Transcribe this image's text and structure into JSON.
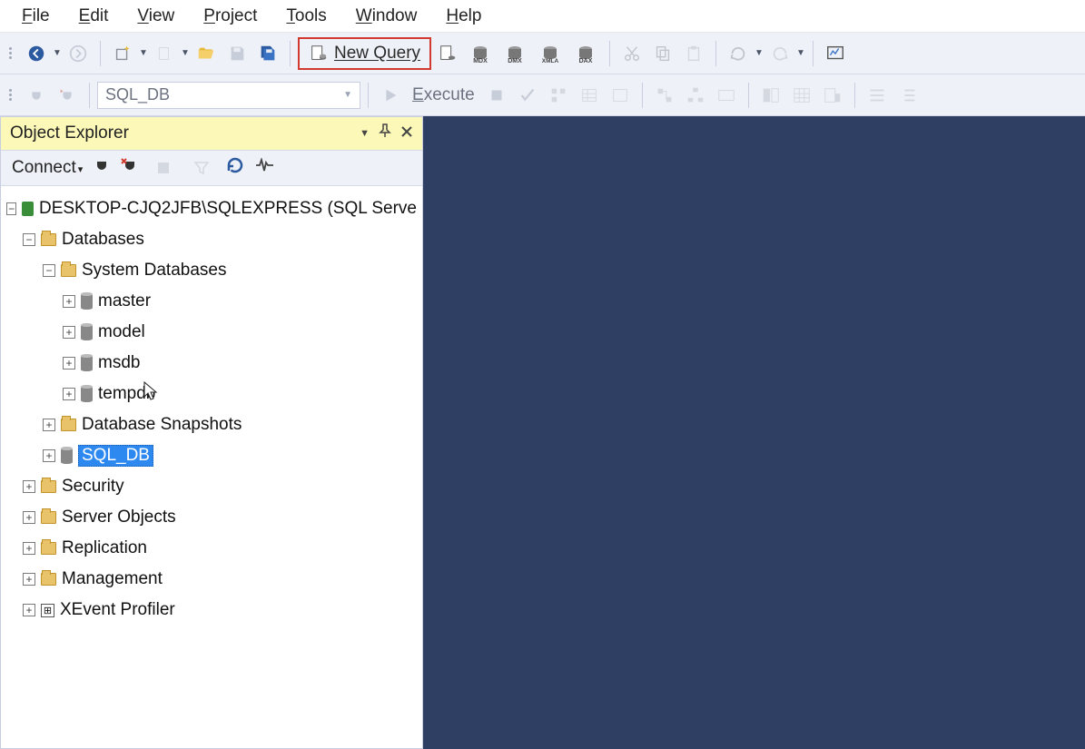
{
  "menu": {
    "items": [
      "File",
      "Edit",
      "View",
      "Project",
      "Tools",
      "Window",
      "Help"
    ]
  },
  "toolbar1": {
    "new_query": "New Query",
    "badges": [
      "MDX",
      "DMX",
      "XMLA",
      "DAX"
    ]
  },
  "toolbar2": {
    "database": "SQL_DB",
    "execute": "Execute"
  },
  "panel": {
    "title": "Object Explorer",
    "connect": "Connect"
  },
  "tree": {
    "server": "DESKTOP-CJQ2JFB\\SQLEXPRESS (SQL Serve",
    "databases": "Databases",
    "system_databases": "System Databases",
    "sysdbs": [
      "master",
      "model",
      "msdb",
      "tempdb"
    ],
    "snapshots": "Database Snapshots",
    "userdb": "SQL_DB",
    "others": [
      "Security",
      "Server Objects",
      "Replication",
      "Management",
      "XEvent Profiler"
    ]
  }
}
